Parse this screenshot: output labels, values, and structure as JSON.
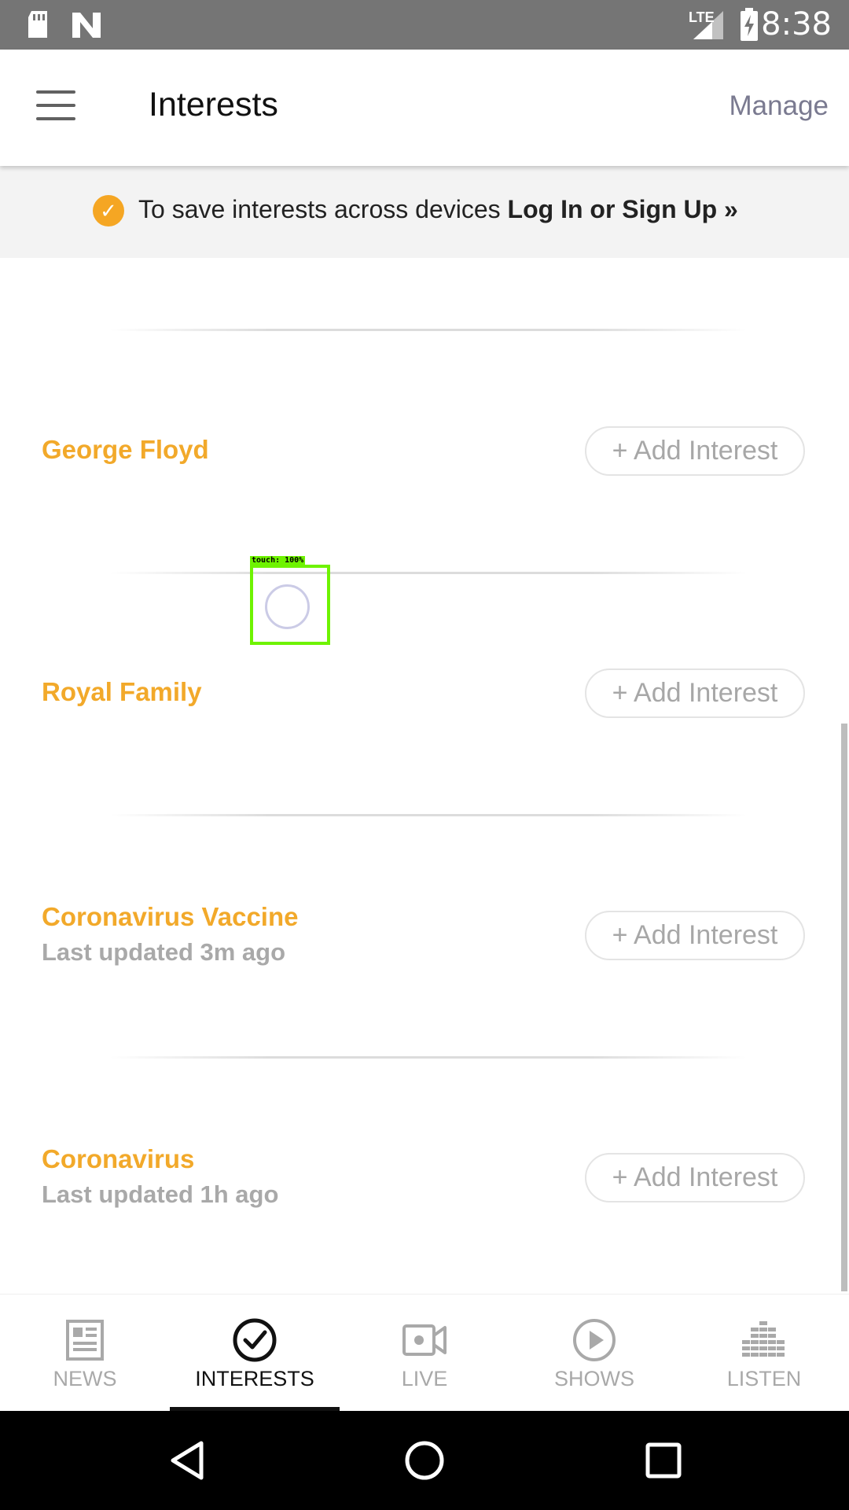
{
  "status_bar": {
    "time": "8:38",
    "network": "LTE",
    "icons": [
      "sd-card-icon",
      "n-logo-icon",
      "signal-icon",
      "battery-charging-icon"
    ]
  },
  "app_bar": {
    "title": "Interests",
    "manage_label": "Manage",
    "menu_icon": "hamburger-menu-icon"
  },
  "banner": {
    "text": "To save interests across devices",
    "link": "Log In or Sign Up »",
    "icon": "check-circle-icon",
    "icon_color": "#f5a623"
  },
  "topics": [
    {
      "name": "George Floyd",
      "subtitle": "",
      "button": "+ Add Interest"
    },
    {
      "name": "Royal Family",
      "subtitle": "",
      "button": "+ Add Interest"
    },
    {
      "name": "Coronavirus Vaccine",
      "subtitle": "Last updated 3m ago",
      "button": "+ Add Interest"
    },
    {
      "name": "Coronavirus",
      "subtitle": "Last updated 1h ago",
      "button": "+ Add Interest"
    }
  ],
  "touch_indicator": {
    "label": "touch: 100%"
  },
  "bottom_nav": {
    "tabs": [
      {
        "label": "NEWS",
        "icon": "newspaper-icon",
        "active": false
      },
      {
        "label": "INTERESTS",
        "icon": "check-circle-icon",
        "active": true
      },
      {
        "label": "LIVE",
        "icon": "video-camera-icon",
        "active": false
      },
      {
        "label": "SHOWS",
        "icon": "play-circle-icon",
        "active": false
      },
      {
        "label": "LISTEN",
        "icon": "equalizer-icon",
        "active": false
      }
    ]
  },
  "system_nav": {
    "icons": [
      "back-icon",
      "home-icon",
      "recents-icon"
    ]
  },
  "colors": {
    "accent": "#f2a92a",
    "muted": "#a9a9a9",
    "status_bar": "#757575"
  }
}
